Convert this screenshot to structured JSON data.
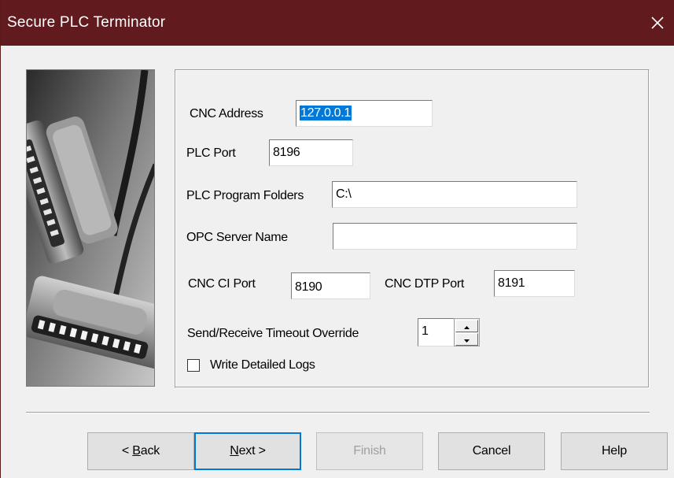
{
  "window": {
    "title": "Secure  PLC Terminator",
    "titlebar_color": "#611a1e"
  },
  "form": {
    "cnc_address_label": "CNC Address",
    "cnc_address_value": "127.0.0.1",
    "plc_port_label": "PLC Port",
    "plc_port_value": "8196",
    "plc_program_folders_label": "PLC Program Folders",
    "plc_program_folders_value": "C:\\",
    "opc_server_name_label": "OPC Server Name",
    "opc_server_name_value": "",
    "cnc_ci_port_label": "CNC CI Port",
    "cnc_ci_port_value": "8190",
    "cnc_dtp_port_label": "CNC DTP Port",
    "cnc_dtp_port_value": "8191",
    "timeout_override_label": "Send/Receive Timeout Override",
    "timeout_override_value": "1",
    "write_logs_label": "Write Detailed Logs",
    "write_logs_checked": false
  },
  "buttons": {
    "back_prefix": "< ",
    "back_mnemonic": "B",
    "back_rest": "ack",
    "next_mnemonic": "N",
    "next_rest": "ext >",
    "finish": "Finish",
    "cancel": "Cancel",
    "help": "Help"
  },
  "colors": {
    "selection": "#0078d7",
    "dialog_bg": "#f0f0f0"
  }
}
